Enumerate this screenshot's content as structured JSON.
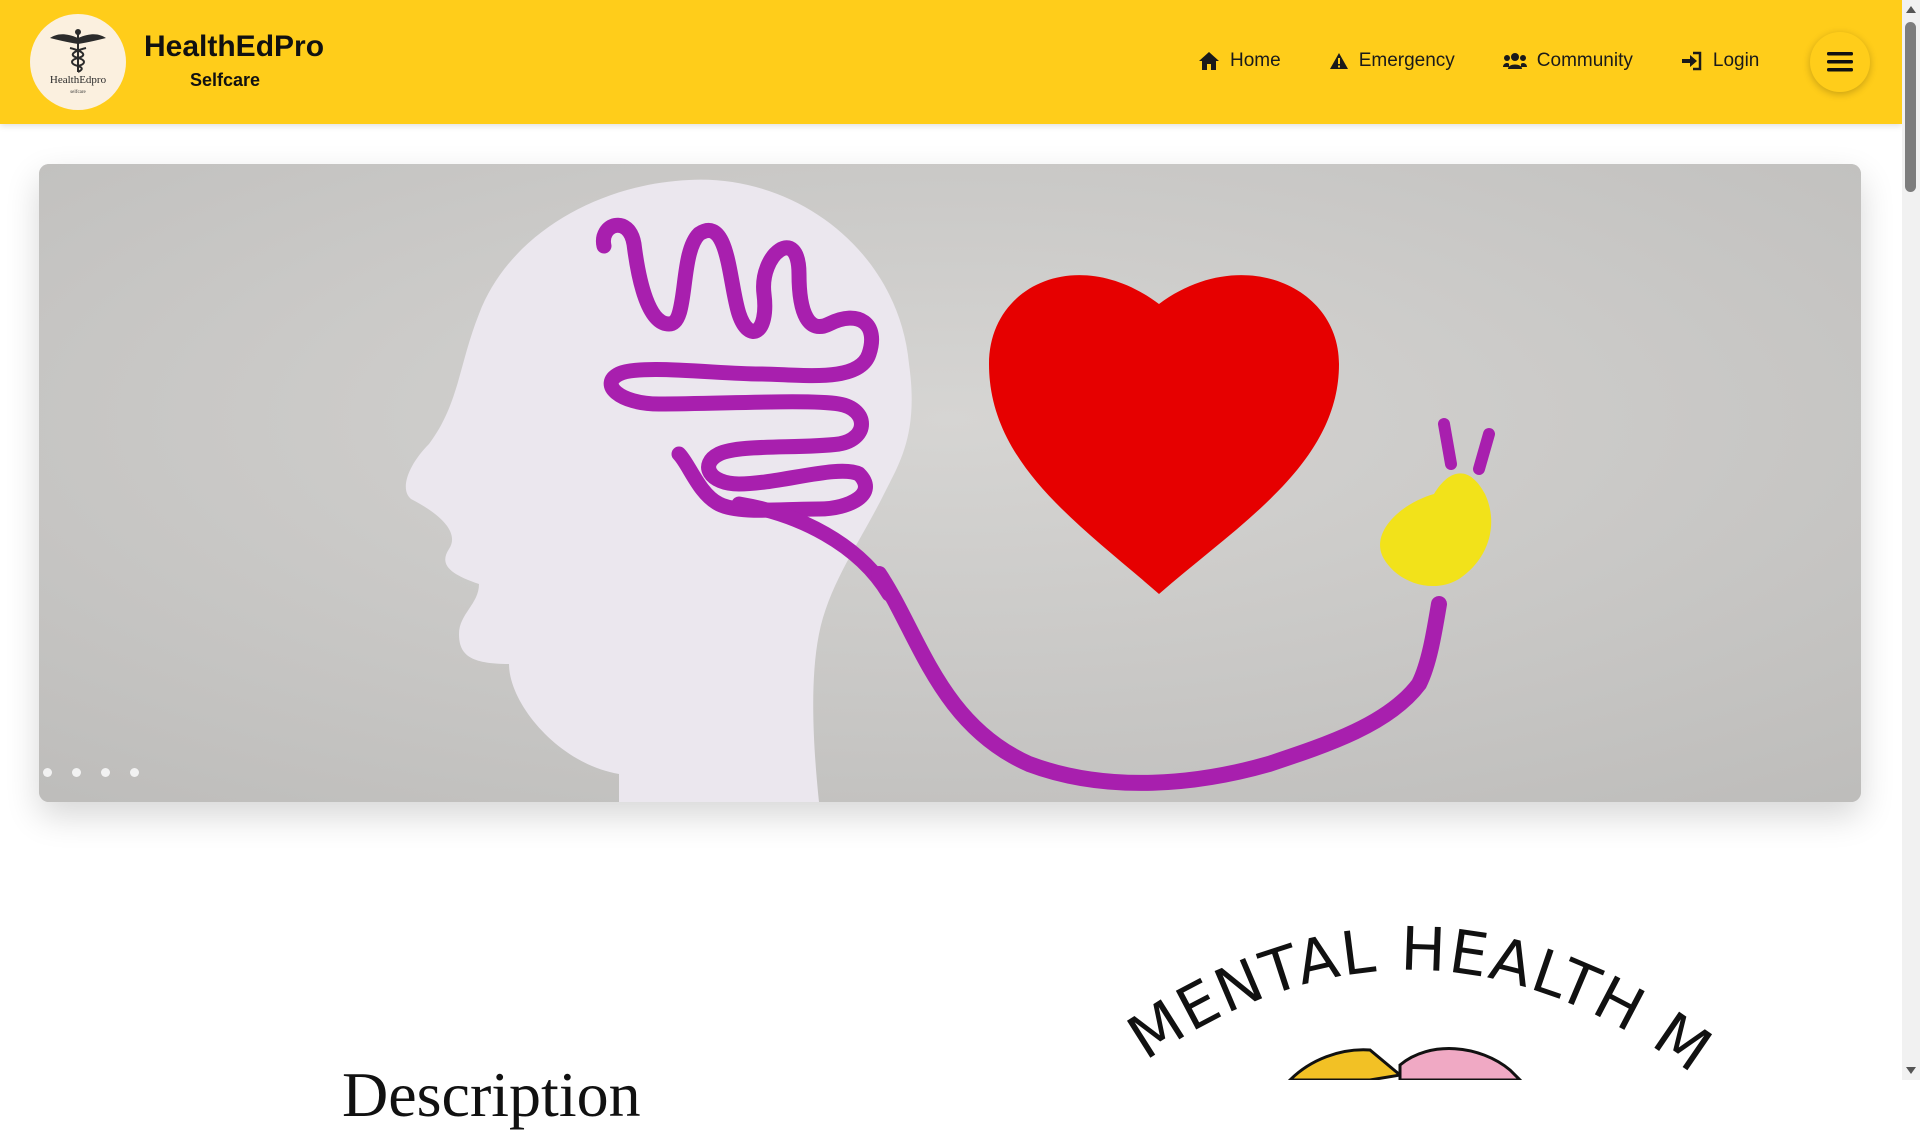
{
  "header": {
    "logo": {
      "text": "HealthEdpro",
      "subtext": "selfcare",
      "icon": "caduceus-icon"
    },
    "brand_title": "HealthEdPro",
    "brand_subtitle": "Selfcare",
    "nav": [
      {
        "label": "Home",
        "icon": "home-icon"
      },
      {
        "label": "Emergency",
        "icon": "warning-icon"
      },
      {
        "label": "Community",
        "icon": "users-icon"
      },
      {
        "label": "Login",
        "icon": "login-icon"
      }
    ],
    "menu_icon": "hamburger-icon"
  },
  "carousel": {
    "image": "head-brain-heart-plug-illustration",
    "slide_count": 4,
    "active_slide": 1
  },
  "section": {
    "title": "Description",
    "graphic_text": "MENTAL HEALTH MATTERS"
  },
  "colors": {
    "header_bg": "#ffcd1a",
    "heart": "#e60000",
    "brain": "#a81fae",
    "plug": "#f2e21a"
  }
}
